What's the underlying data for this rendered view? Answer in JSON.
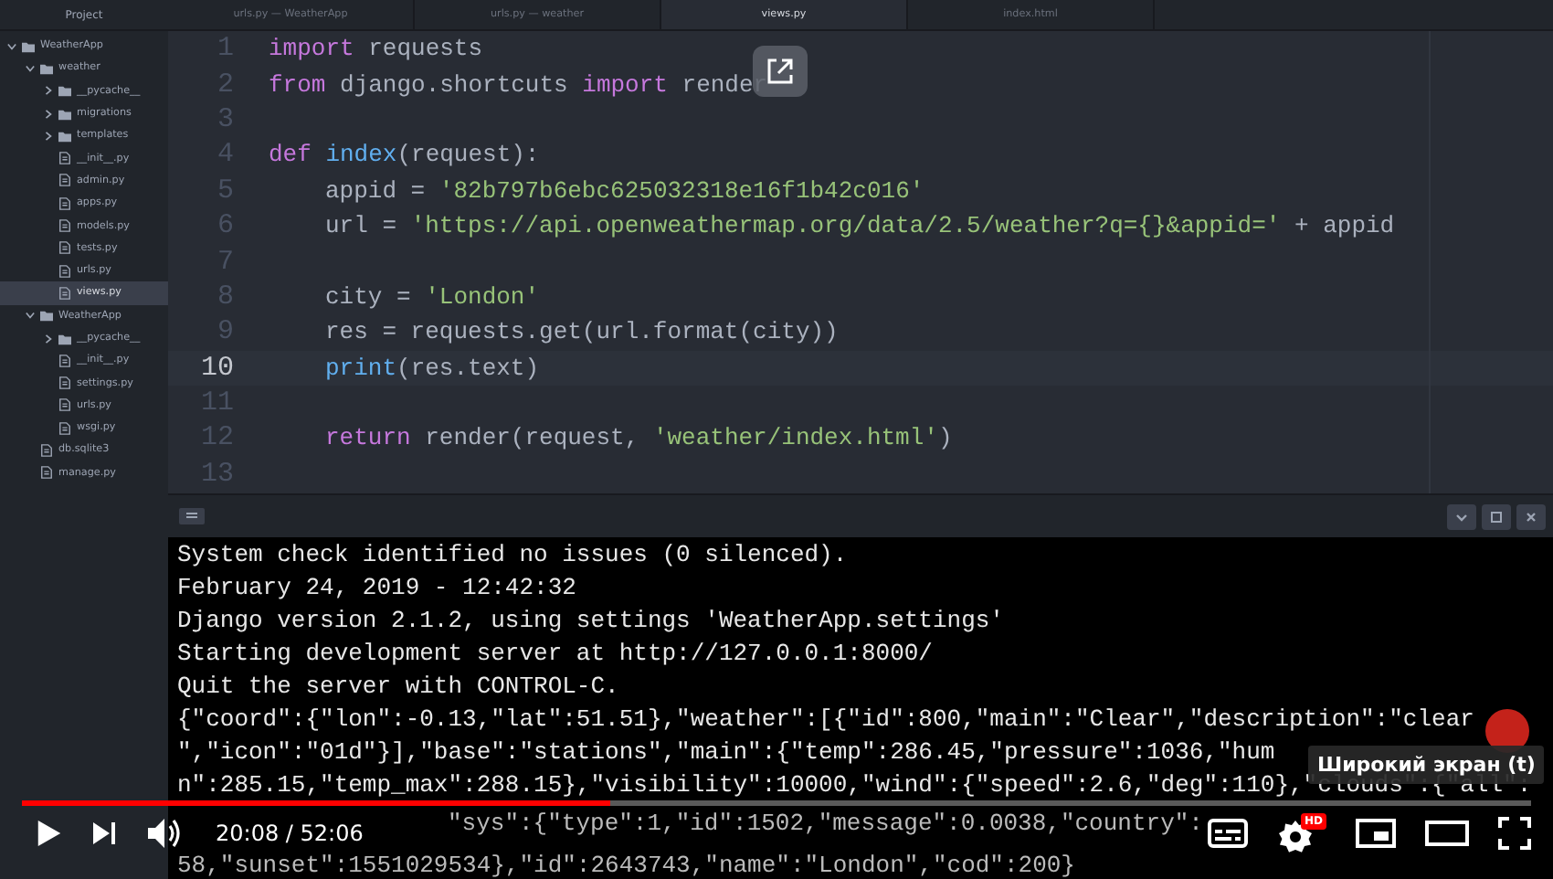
{
  "sidebar": {
    "title": "Project",
    "tree": [
      {
        "label": "WeatherApp",
        "kind": "folder",
        "expanded": true,
        "selected": false,
        "children": [
          {
            "label": "weather",
            "kind": "folder",
            "expanded": true,
            "selected": false,
            "children": [
              {
                "label": "__pycache__",
                "kind": "folder",
                "expanded": false,
                "selected": false
              },
              {
                "label": "migrations",
                "kind": "folder",
                "expanded": false,
                "selected": false
              },
              {
                "label": "templates",
                "kind": "folder",
                "expanded": false,
                "selected": false
              },
              {
                "label": "__init__.py",
                "kind": "file",
                "selected": false
              },
              {
                "label": "admin.py",
                "kind": "file",
                "selected": false
              },
              {
                "label": "apps.py",
                "kind": "file",
                "selected": false
              },
              {
                "label": "models.py",
                "kind": "file",
                "selected": false
              },
              {
                "label": "tests.py",
                "kind": "file",
                "selected": false
              },
              {
                "label": "urls.py",
                "kind": "file",
                "selected": false
              },
              {
                "label": "views.py",
                "kind": "file",
                "selected": true
              }
            ]
          },
          {
            "label": "WeatherApp",
            "kind": "folder",
            "expanded": true,
            "selected": false,
            "children": [
              {
                "label": "__pycache__",
                "kind": "folder",
                "expanded": false,
                "selected": false
              },
              {
                "label": "__init__.py",
                "kind": "file",
                "selected": false
              },
              {
                "label": "settings.py",
                "kind": "file",
                "selected": false
              },
              {
                "label": "urls.py",
                "kind": "file",
                "selected": false
              },
              {
                "label": "wsgi.py",
                "kind": "file",
                "selected": false
              }
            ]
          },
          {
            "label": "db.sqlite3",
            "kind": "file",
            "selected": false
          },
          {
            "label": "manage.py",
            "kind": "file",
            "selected": false
          }
        ]
      }
    ]
  },
  "tabs": [
    {
      "label": "urls.py — WeatherApp",
      "selected": false
    },
    {
      "label": "urls.py — weather",
      "selected": false
    },
    {
      "label": "views.py",
      "selected": true
    },
    {
      "label": "index.html",
      "selected": false
    }
  ],
  "editor": {
    "lines": [
      {
        "number": "1",
        "current": false,
        "indented": false,
        "tokens": [
          {
            "kind": "keyword",
            "text": "import"
          },
          {
            "kind": "plain",
            "text": " requests"
          }
        ]
      },
      {
        "number": "2",
        "current": false,
        "indented": false,
        "tokens": [
          {
            "kind": "keyword",
            "text": "from"
          },
          {
            "kind": "plain",
            "text": " django.shortcuts "
          },
          {
            "kind": "keyword",
            "text": "import"
          },
          {
            "kind": "plain",
            "text": " render"
          }
        ]
      },
      {
        "number": "3",
        "current": false
      },
      {
        "number": "4",
        "current": false,
        "indented": false,
        "tokens": [
          {
            "kind": "keyword",
            "text": "def"
          },
          {
            "kind": "function",
            "text": " index"
          },
          {
            "kind": "plain",
            "text": "(request):"
          }
        ]
      },
      {
        "number": "5",
        "current": false,
        "indented": true,
        "tokens": [
          {
            "kind": "plain",
            "text": "appid = "
          },
          {
            "kind": "string",
            "text": "'82b797b6ebc625032318e16f1b42c016'"
          }
        ]
      },
      {
        "number": "6",
        "current": false,
        "indented": true,
        "tokens": [
          {
            "kind": "plain",
            "text": "url = "
          },
          {
            "kind": "string",
            "text": "'https://api.openweathermap.org/data/2.5/weather?q={}&appid='"
          },
          {
            "kind": "plain",
            "text": " + appid"
          }
        ]
      },
      {
        "number": "7",
        "current": false
      },
      {
        "number": "8",
        "current": false,
        "indented": true,
        "tokens": [
          {
            "kind": "plain",
            "text": "city = "
          },
          {
            "kind": "string",
            "text": "'London'"
          }
        ]
      },
      {
        "number": "9",
        "current": false,
        "indented": true,
        "tokens": [
          {
            "kind": "plain",
            "text": "res = requests.get(url.format(city))"
          }
        ]
      },
      {
        "number": "10",
        "current": true,
        "indented": true,
        "tokens": [
          {
            "kind": "function",
            "text": "print"
          },
          {
            "kind": "plain",
            "text": "(res.text)"
          }
        ]
      },
      {
        "number": "11",
        "current": false
      },
      {
        "number": "12",
        "current": false,
        "indented": true,
        "tokens": [
          {
            "kind": "keyword",
            "text": "return"
          },
          {
            "kind": "plain",
            "text": " render(request, "
          },
          {
            "kind": "string",
            "text": "'weather/index.html'"
          },
          {
            "kind": "plain",
            "text": ")"
          }
        ]
      },
      {
        "number": "13",
        "current": false
      }
    ]
  },
  "console": {
    "lines": [
      "System check identified no issues (0 silenced).",
      "February 24, 2019 - 12:42:32",
      "Django version 2.1.2, using settings 'WeatherApp.settings'",
      "Starting development server at http://127.0.0.1:8000/",
      "Quit the server with CONTROL-C.",
      "{\"coord\":{\"lon\":-0.13,\"lat\":51.51},\"weather\":[{\"id\":800,\"main\":\"Clear\",\"description\":\"clear",
      "\",\"icon\":\"01d\"}],\"base\":\"stations\",\"main\":{\"temp\":286.45,\"pressure\":1036,\"hum",
      "n\":285.15,\"temp_max\":288.15},\"visibility\":10000,\"wind\":{\"speed\":2.6,\"deg\":110},\"clouds\":{\"all\":"
    ],
    "partial_line": "\"sys\":{\"type\":1,\"id\":1502,\"message\":0.0038,\"country\":",
    "bottom_line": "58,\"sunset\":1551029534},\"id\":2643743,\"name\":\"London\",\"cod\":200}"
  },
  "player": {
    "progress": {
      "level": 0.39
    },
    "time": "20:08 / 52:06",
    "quality_badge": "HD",
    "tooltip": "Широкий экран (t)"
  }
}
